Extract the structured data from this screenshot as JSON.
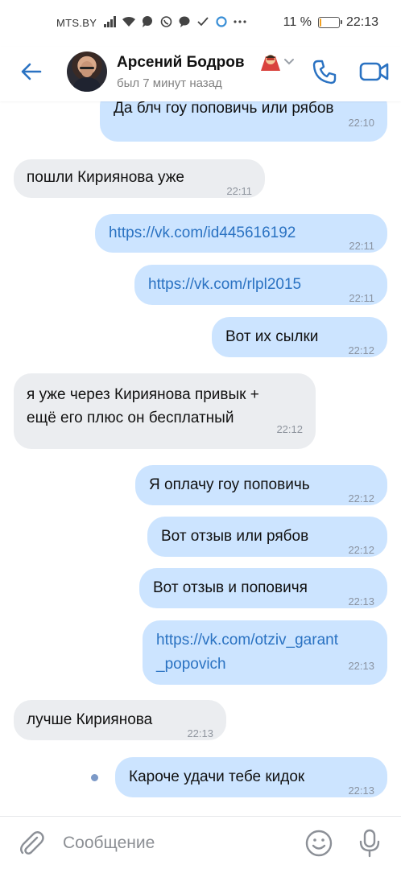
{
  "status_bar": {
    "carrier": "MTS.BY",
    "battery_percent": "11 %",
    "battery_level": 0.11,
    "time": "22:13",
    "icons": [
      "signal-icon",
      "wifi-icon",
      "chat-icon",
      "viber-icon",
      "message-icon",
      "check-icon",
      "app-icon",
      "more-dots-icon"
    ]
  },
  "header": {
    "contact_name": "Арсений Бодров",
    "last_seen": "был 7 минут назад",
    "icons": [
      "back-arrow-icon",
      "phone-icon",
      "video-camera-icon"
    ]
  },
  "messages": [
    {
      "dir": "out",
      "text": "Да блч гоу поповичь или рябов",
      "time": "22:10",
      "link": false
    },
    {
      "dir": "in",
      "text": "пошли Кириянова уже",
      "time": "22:11",
      "link": false
    },
    {
      "dir": "out",
      "text": "https://vk.com/id445616192",
      "time": "22:11",
      "link": true
    },
    {
      "dir": "out",
      "text": "https://vk.com/rlpl2015",
      "time": "22:11",
      "link": true
    },
    {
      "dir": "out",
      "text": "Вот их сылки",
      "time": "22:12",
      "link": false
    },
    {
      "dir": "in",
      "lines": [
        "я уже через Кириянова привык +",
        "ещё его плюс он бесплатный"
      ],
      "time": "22:12",
      "link": false
    },
    {
      "dir": "out",
      "text": "Я оплачу гоу поповичь",
      "time": "22:12",
      "link": false
    },
    {
      "dir": "out",
      "text": "Вот отзыв или рябов",
      "time": "22:12",
      "link": false
    },
    {
      "dir": "out",
      "text": "Вот отзыв и поповичя",
      "time": "22:13",
      "link": false
    },
    {
      "dir": "out",
      "lines": [
        "https://vk.com/otziv_garant",
        "_popovich"
      ],
      "time": "22:13",
      "link": true
    },
    {
      "dir": "in",
      "text": "лучше Кириянова",
      "time": "22:13",
      "link": false
    },
    {
      "dir": "out",
      "text": "Кароче удачи тебе кидок",
      "time": "22:13",
      "link": false,
      "unread": true
    }
  ],
  "composer": {
    "placeholder": "Сообщение"
  },
  "colors": {
    "accent": "#2a72c2",
    "bubble_out": "#cce4ff",
    "bubble_in": "#ebedf0",
    "unread_dot": "#7c99c7"
  }
}
